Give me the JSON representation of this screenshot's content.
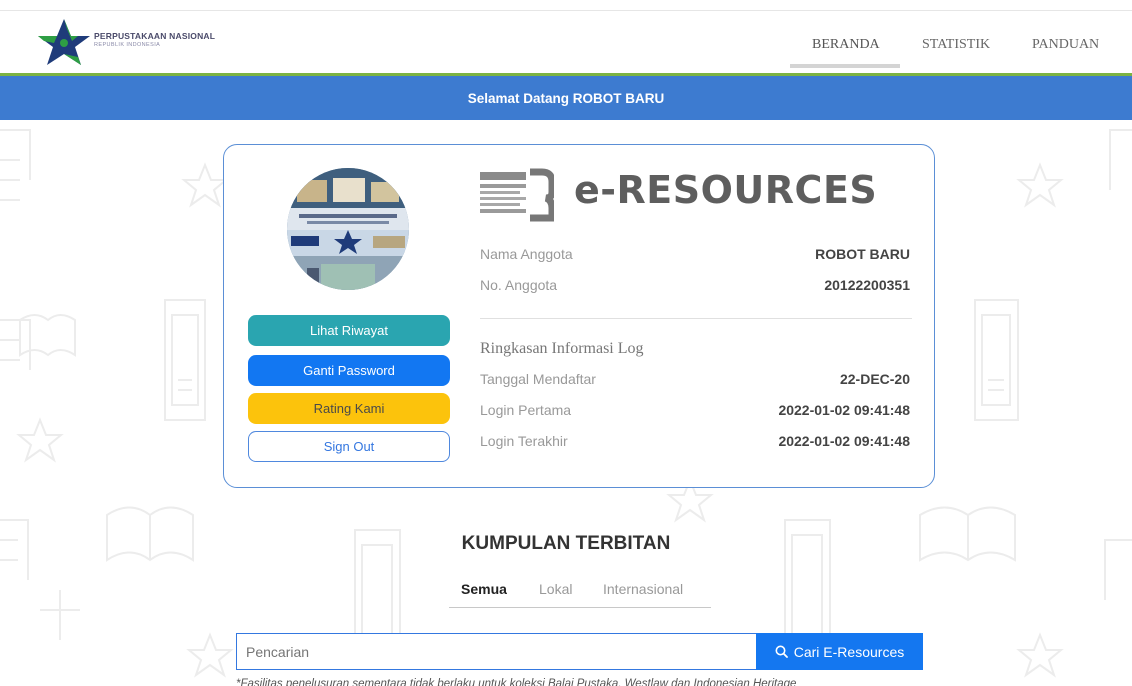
{
  "header": {
    "brand_name": "PERPUSTAKAAN NASIONAL",
    "brand_sub": "REPUBLIK INDONESIA",
    "nav": [
      {
        "label": "BERANDA",
        "active": true
      },
      {
        "label": "STATISTIK",
        "active": false
      },
      {
        "label": "PANDUAN",
        "active": false
      }
    ]
  },
  "welcome": "Selamat Datang ROBOT BARU",
  "profile": {
    "buttons": {
      "riwayat": "Lihat Riwayat",
      "password": "Ganti Password",
      "rating": "Rating Kami",
      "signout": "Sign Out"
    },
    "brand_title": "e-RESOURCES",
    "member": {
      "name_label": "Nama Anggota",
      "name_value": "ROBOT BARU",
      "number_label": "No. Anggota",
      "number_value": "20122200351"
    },
    "log": {
      "title": "Ringkasan Informasi Log",
      "rows": [
        {
          "label": "Tanggal Mendaftar",
          "value": "22-DEC-20"
        },
        {
          "label": "Login Pertama",
          "value": "2022-01-02 09:41:48"
        },
        {
          "label": "Login Terakhir",
          "value": "2022-01-02 09:41:48"
        }
      ]
    }
  },
  "collections": {
    "title": "KUMPULAN TERBITAN",
    "tabs": [
      {
        "label": "Semua",
        "active": true
      },
      {
        "label": "Lokal",
        "active": false
      },
      {
        "label": "Internasional",
        "active": false
      }
    ],
    "search": {
      "placeholder": "Pencarian",
      "button_label": "Cari E-Resources"
    },
    "footnote": "*Fasilitas penelusuran sementara tidak berlaku untuk koleksi Balai Pustaka, Westlaw dan Indonesian Heritage"
  },
  "colors": {
    "primary_blue": "#3d7bd0",
    "accent_green": "#7cb342",
    "teal": "#2aa5b0",
    "blue": "#1277f2",
    "yellow": "#fcc30c"
  }
}
